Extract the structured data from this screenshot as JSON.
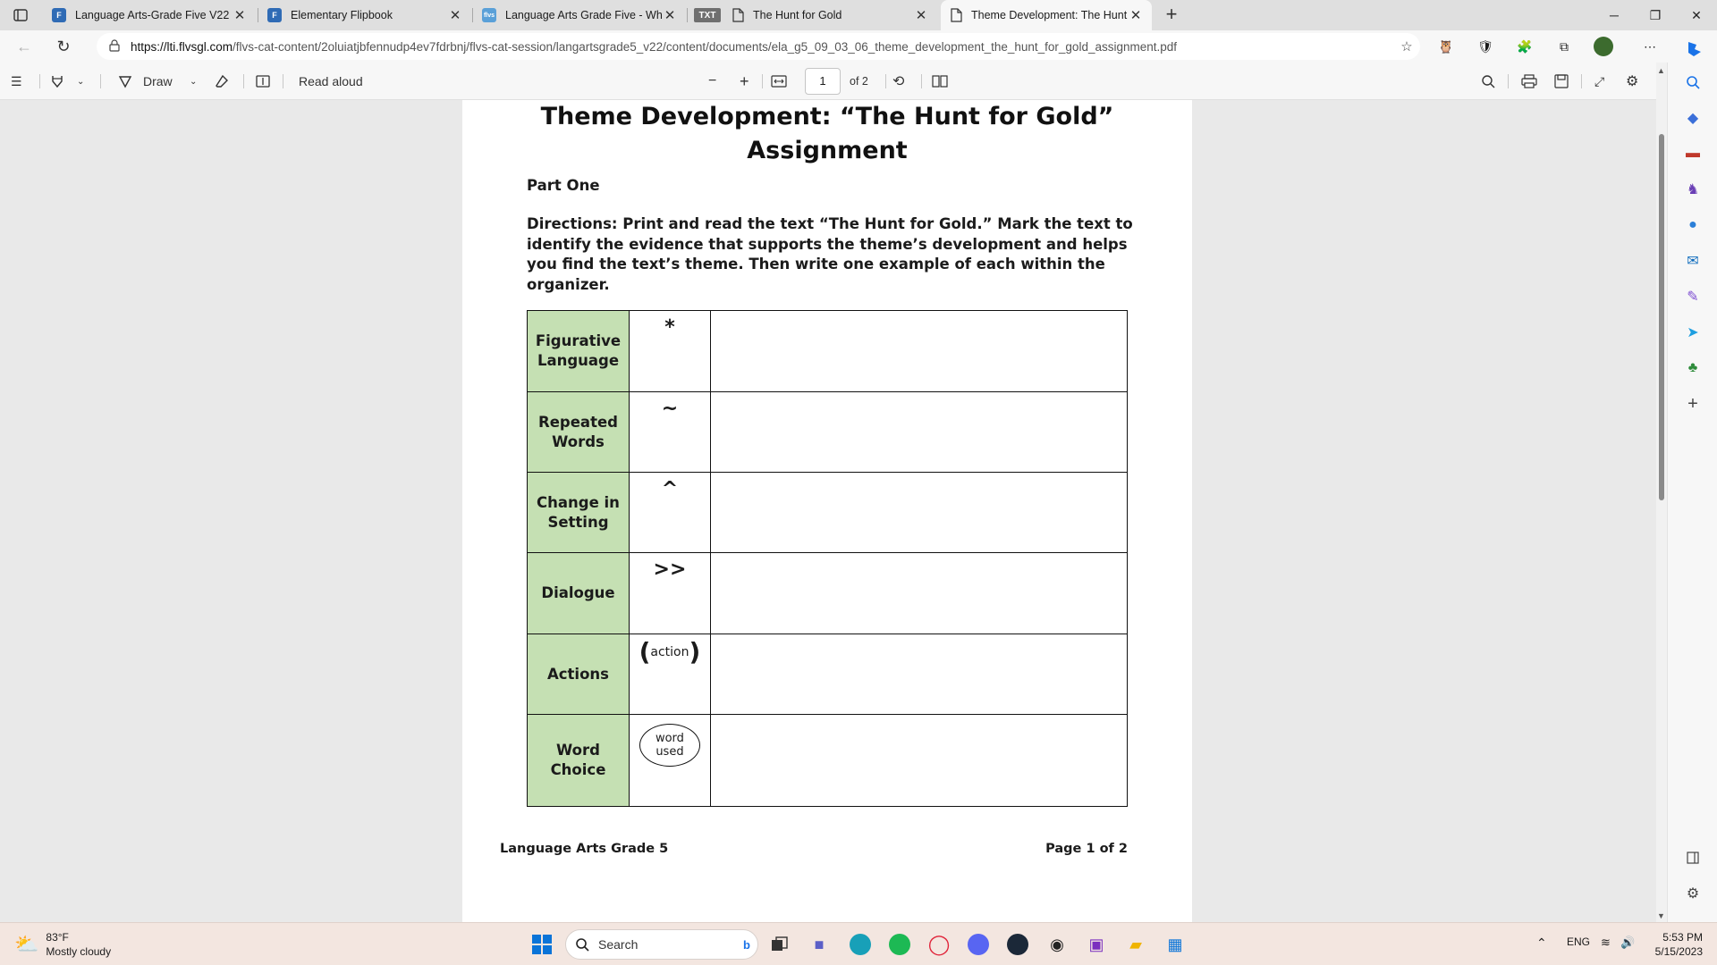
{
  "browser": {
    "tabs": [
      {
        "title": "Language Arts-Grade Five V22 (",
        "icon": "flvs-logo"
      },
      {
        "title": "Elementary Flipbook",
        "icon": "flvs-logo"
      },
      {
        "title": "Language Arts Grade Five - Wha",
        "icon": "flvs-badge",
        "badge": "flvs"
      },
      {
        "title": "The Hunt for Gold",
        "icon": "txt-badge",
        "badge": "TXT"
      },
      {
        "title": "Theme Development: The Hunt f",
        "icon": "document",
        "active": true
      }
    ],
    "url_host": "https://lti.flvsgl.com",
    "url_path": "/flvs-cat-content/2oluiatjbfennudp4ev7fdrbnj/flvs-cat-session/langartsgrade5_v22/content/documents/ela_g5_09_03_06_theme_development_the_hunt_for_gold_assignment.pdf"
  },
  "pdf_toolbar": {
    "draw_label": "Draw",
    "read_aloud_label": "Read aloud",
    "page_number": "1",
    "page_total": "of 2"
  },
  "document": {
    "title_line1": "Theme Development: “The Hunt for Gold”",
    "title_line2": "Assignment",
    "part": "Part One",
    "directions": "Directions: Print and read the text “The Hunt for Gold.” Mark the text to identify the evidence that supports the theme’s development and helps you find the text’s theme. Then write one example of each within the organizer.",
    "rows": [
      {
        "label_1": "Figurative",
        "label_2": "Language",
        "symbol": "*"
      },
      {
        "label_1": "Repeated",
        "label_2": "Words",
        "symbol": "~"
      },
      {
        "label_1": "Change in",
        "label_2": "Setting",
        "symbol": "^"
      },
      {
        "label_1": "Dialogue",
        "label_2": "",
        "symbol": ">>"
      },
      {
        "label_1": "Actions",
        "label_2": "",
        "symbol": "action"
      },
      {
        "label_1": "Word",
        "label_2": "Choice",
        "symbol_1": "word",
        "symbol_2": "used"
      }
    ],
    "footer_left": "Language Arts Grade 5",
    "footer_right": "Page 1 of 2"
  },
  "taskbar": {
    "temperature": "83°F",
    "weather": "Mostly cloudy",
    "search_placeholder": "Search",
    "language": "ENG",
    "time": "5:53 PM",
    "date": "5/15/2023"
  },
  "colors": {
    "label_fill": "#c5e0b3",
    "tab_strip": "#dfdfdf",
    "viewer_bg": "#e9e9e9",
    "taskbar": "#f3e6e0"
  }
}
